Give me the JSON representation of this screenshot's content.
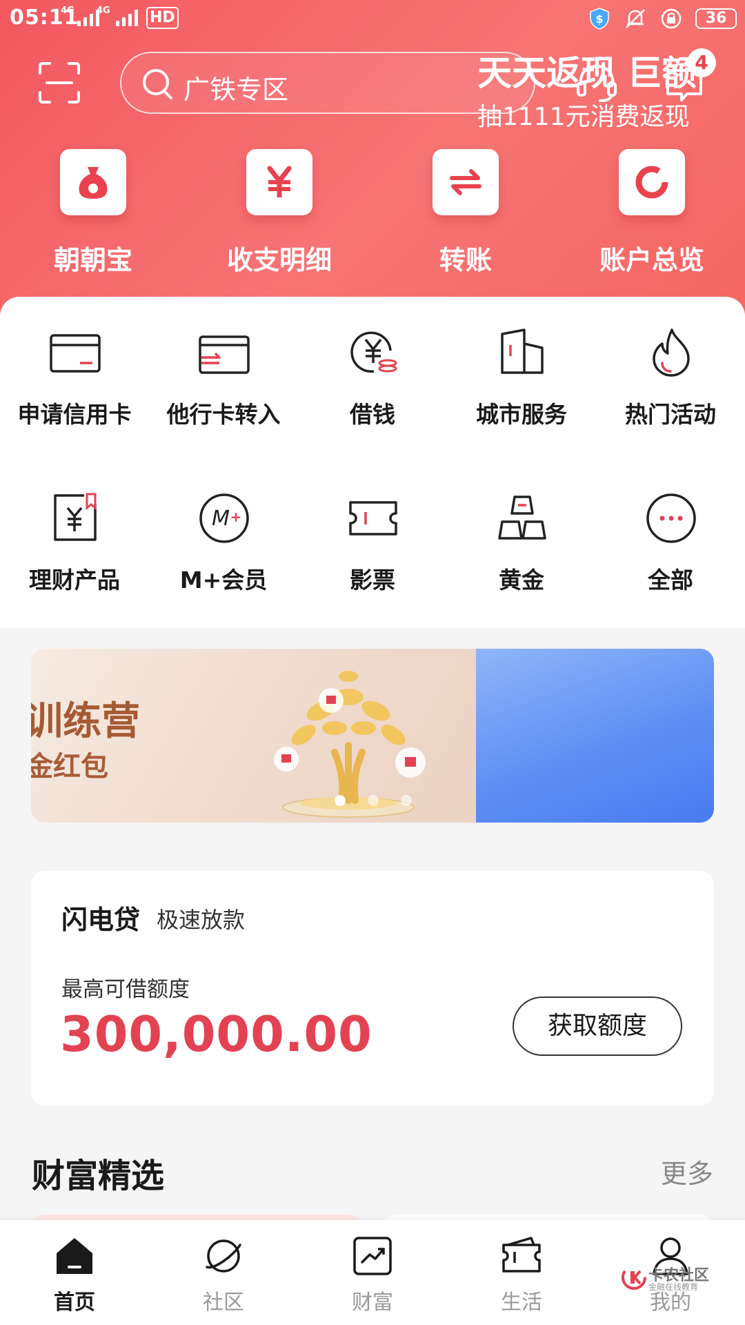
{
  "status_bar": {
    "time": "05:11",
    "signal1_tag": "4G",
    "signal2_tag": "4G",
    "hd": "HD",
    "battery": "36"
  },
  "top_bar": {
    "search_placeholder": "广铁专区",
    "message_count": "4"
  },
  "quick_entries": [
    {
      "label": "朝朝宝",
      "icon": "money-bag-icon"
    },
    {
      "label": "收支明细",
      "icon": "yuan-icon"
    },
    {
      "label": "转账",
      "icon": "transfer-arrows-icon"
    },
    {
      "label": "账户总览",
      "icon": "ring-chart-icon"
    }
  ],
  "services": [
    {
      "label": "申请信用卡",
      "icon": "credit-card-icon"
    },
    {
      "label": "他行卡转入",
      "icon": "card-transfer-icon"
    },
    {
      "label": "借钱",
      "icon": "yuan-coin-icon"
    },
    {
      "label": "城市服务",
      "icon": "city-buildings-icon"
    },
    {
      "label": "热门活动",
      "icon": "flame-icon"
    },
    {
      "label": "理财产品",
      "icon": "finance-doc-icon"
    },
    {
      "label": "M+会员",
      "icon": "m-plus-icon"
    },
    {
      "label": "影票",
      "icon": "ticket-icon"
    },
    {
      "label": "黄金",
      "icon": "gold-bars-icon"
    },
    {
      "label": "全部",
      "icon": "more-dots-icon"
    }
  ],
  "banner": {
    "left_title": "训练营",
    "left_subtitle": "金红包",
    "right_title": "天天返现 巨额",
    "right_subtitle": "抽1111元消费返现",
    "dots": 3,
    "active_dot": 0
  },
  "loan": {
    "title": "闪电贷",
    "tag": "极速放款",
    "amount_label": "最高可借额度",
    "amount": "300,000.00",
    "button": "获取额度"
  },
  "wealth": {
    "title": "财富精选",
    "more": "更多"
  },
  "tabs": [
    {
      "label": "首页",
      "icon": "home-icon",
      "active": true
    },
    {
      "label": "社区",
      "icon": "planet-icon",
      "active": false
    },
    {
      "label": "财富",
      "icon": "chart-trend-icon",
      "active": false
    },
    {
      "label": "生活",
      "icon": "ticket-life-icon",
      "active": false
    },
    {
      "label": "我的",
      "icon": "user-icon",
      "active": false
    }
  ],
  "watermark": {
    "name": "卡农社区",
    "sub": "金融在线教育"
  },
  "colors": {
    "header_red": "#f2585f",
    "accent_red": "#e34252",
    "banner_blue": "#4a7bf0"
  }
}
